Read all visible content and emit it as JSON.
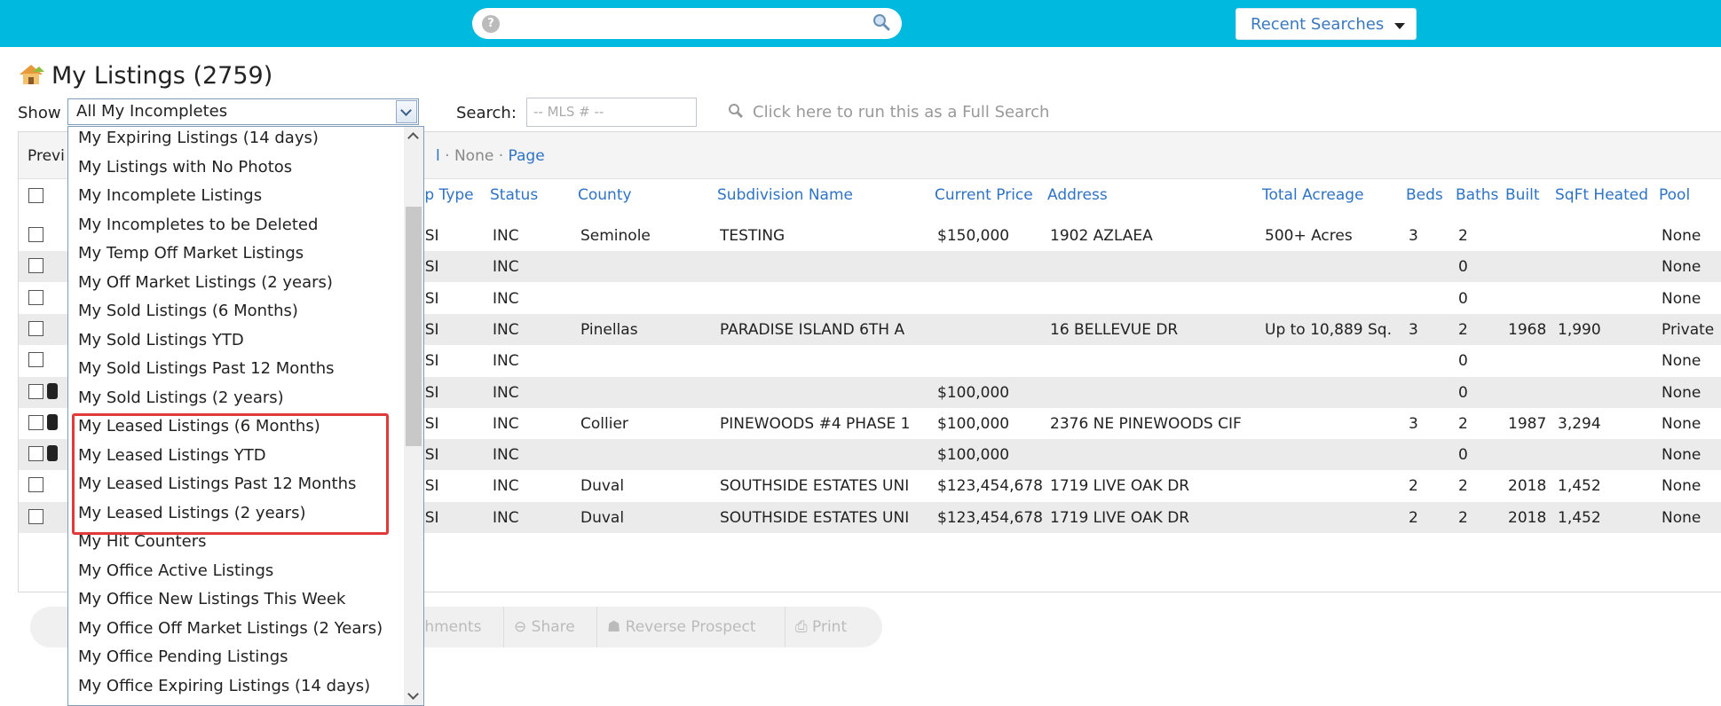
{
  "topbar": {
    "recent_searches": "Recent Searches"
  },
  "page": {
    "title": "My Listings (2759)",
    "show_label": "Show",
    "show_value": "All My Incompletes",
    "search_label": "Search:",
    "search_placeholder": "-- MLS # --",
    "full_search": "Click here to run this as a Full Search"
  },
  "panel": {
    "preview_label": "Previ",
    "select_links": [
      "l",
      "None",
      "Page"
    ]
  },
  "table": {
    "columns": [
      "op Type",
      "Status",
      "County",
      "Subdivision Name",
      "Current Price",
      "Address",
      "Total Acreage",
      "Beds",
      "Baths",
      "Built",
      "SqFt Heated",
      "Pool"
    ],
    "rows": [
      [
        "ESI",
        "INC",
        "Seminole",
        "TESTING",
        "$150,000",
        "1902 AZLAEA",
        "500+ Acres",
        "3",
        "2",
        "",
        "",
        "None"
      ],
      [
        "ESI",
        "INC",
        "",
        "",
        "",
        "",
        "",
        "",
        "0",
        "",
        "",
        "None"
      ],
      [
        "ESI",
        "INC",
        "",
        "",
        "",
        "",
        "",
        "",
        "0",
        "",
        "",
        "None"
      ],
      [
        "ESI",
        "INC",
        "Pinellas",
        "PARADISE ISLAND 6TH A",
        "",
        "16 BELLEVUE DR",
        "Up to 10,889 Sq.",
        "3",
        "2",
        "1968",
        "1,990",
        "Private"
      ],
      [
        "ESI",
        "INC",
        "",
        "",
        "",
        "",
        "",
        "",
        "0",
        "",
        "",
        "None"
      ],
      [
        "ESI",
        "INC",
        "",
        "",
        "$100,000",
        "",
        "",
        "",
        "0",
        "",
        "",
        "None"
      ],
      [
        "ESI",
        "INC",
        "Collier",
        "PINEWOODS #4 PHASE 1",
        "$100,000",
        "2376 NE PINEWOODS CIF",
        "",
        "3",
        "2",
        "1987",
        "3,294",
        "None"
      ],
      [
        "ESI",
        "INC",
        "",
        "",
        "$100,000",
        "",
        "",
        "",
        "0",
        "",
        "",
        "None"
      ],
      [
        "ESI",
        "INC",
        "Duval",
        "SOUTHSIDE ESTATES UNI",
        "$123,454,678",
        "1719 LIVE OAK DR",
        "",
        "2",
        "2",
        "2018",
        "1,452",
        "None"
      ],
      [
        "ESI",
        "INC",
        "Duval",
        "SOUTHSIDE ESTATES UNI",
        "$123,454,678",
        "1719 LIVE OAK DR",
        "",
        "2",
        "2",
        "2018",
        "1,452",
        "None"
      ]
    ],
    "row_icons": [
      false,
      false,
      false,
      false,
      false,
      true,
      true,
      true,
      false,
      false
    ]
  },
  "toolbar": {
    "attachments": "chments",
    "share": "Share",
    "reverse_prospect": "Reverse Prospect",
    "print": "Print"
  },
  "dropdown": {
    "options": [
      "My Expiring Listings (14 days)",
      "My Listings with No Photos",
      "My Incomplete Listings",
      "My Incompletes to be Deleted",
      "My Temp Off Market Listings",
      "My Off Market Listings (2 years)",
      "My Sold Listings (6 Months)",
      "My Sold Listings YTD",
      "My Sold Listings Past 12 Months",
      "My Sold Listings (2 years)",
      "My Leased Listings (6 Months)",
      "My Leased Listings YTD",
      "My Leased Listings Past 12 Months",
      "My Leased Listings (2 years)",
      "My Hit Counters",
      "My Office Active Listings",
      "My Office New Listings This Week",
      "My Office Off Market Listings (2 Years)",
      "My Office Pending Listings",
      "My Office Expiring Listings (14 days)"
    ]
  },
  "colors": {
    "topbar": "#00b9de",
    "link": "#2f73c4",
    "highlight": "#e03a3a"
  }
}
